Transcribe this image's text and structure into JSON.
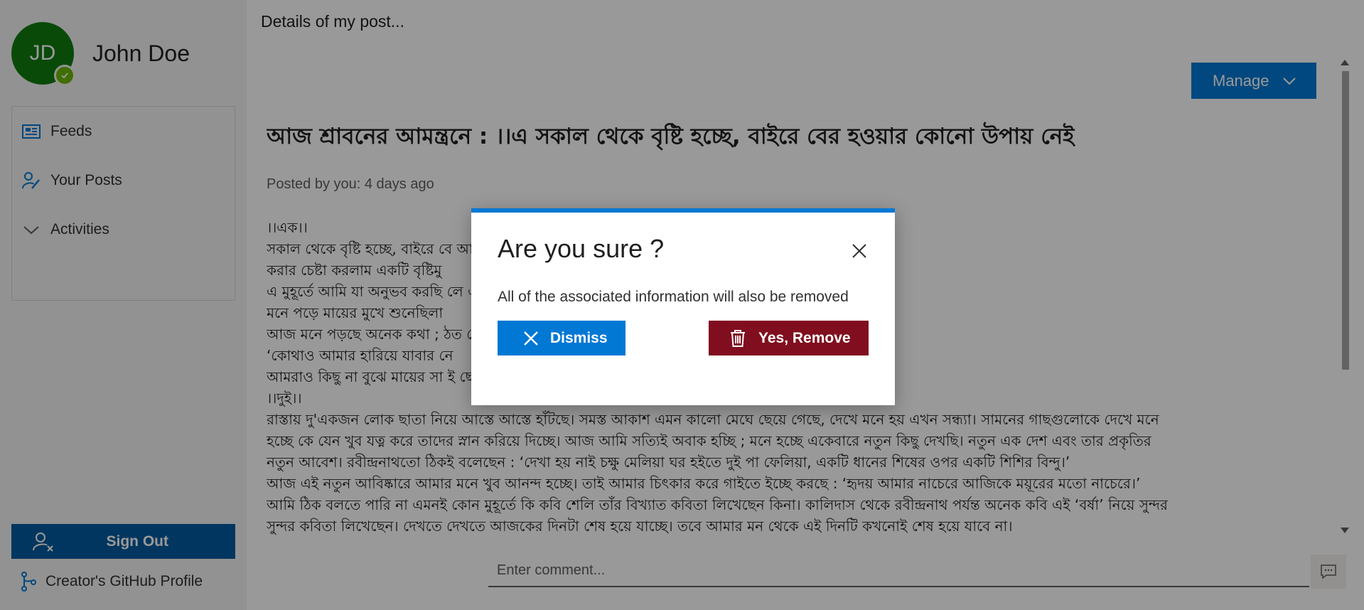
{
  "sidebar": {
    "avatar_initials": "JD",
    "user_name": "John Doe",
    "items": [
      {
        "label": "Feeds",
        "icon": "news-icon"
      },
      {
        "label": "Your Posts",
        "icon": "edit-person-icon"
      },
      {
        "label": "Activities",
        "icon": "chevron-down-icon"
      }
    ],
    "sign_out_label": "Sign Out",
    "github_label": "Creator's GitHub Profile"
  },
  "main": {
    "breadcrumb": "Details of my post...",
    "manage_label": "Manage",
    "post_title": "আজ শ্রাবনের আমন্ত্রনে : ।।এ সকাল থেকে বৃষ্টি হচ্ছে, বাইরে বের হওয়ার কোনো উপায় নেই",
    "post_meta": "Posted by you: 4 days ago",
    "body_lines": [
      "।।এক।।",
      "সকাল থেকে বৃষ্টি হচ্ছে, বাইরে বে                                                                আছি। এভাবেই আজকের দিনটি কাটিয়ে দিলাম। আর অনুভব",
      "করার চেষ্টা করলাম একটি বৃষ্টিমু",
      "এ মুহূর্তে আমি যা অনুভব করছি                                                                 লে এখনই রবীন্দ্রনাথের মতো লিখে ফেলতাম একটি কবিতা -",
      "মনে পড়ে মায়ের মুখে শুনেছিলা",
      "আজ মনে পড়ছে অনেক কথা ;                                                                   ঠত সেই গান –",
      "‘কোথাও আমার হারিয়ে যাবার নে",
      "আমরাও কিছু না বুঝে মায়ের সা                                                                 ই ছেলেবেলার দিনগুলোর কোন তুলনাই হয়না।",
      "।।দুই।।",
      "রাস্তায় দু'একজন লোক ছাতা নিয়ে আস্তে আস্তে হাঁটছে। সমস্ত আকাশ এমন কালো মেঘে ছেয়ে গেছে, দেখে মনে হয় এখন সন্ধ্যা। সামনের গাছগুলোকে দেখে মনে",
      "হচ্ছে কে যেন খুব যত্ন করে তাদের স্নান করিয়ে দিচ্ছে। আজ আমি সত্যিই অবাক হচ্ছি ; মনে হচ্ছে একেবারে নতুন কিছু দেখছি। নতুন এক দেশ এবং তার প্রকৃতির",
      "নতুন আবেশ। রবীন্দ্রনাথতো ঠিকই বলেছেন : ‘দেখা হয় নাই চক্ষু মেলিয়া ঘর হইতে দুই পা ফেলিয়া, একটি ধানের শিষের ওপর একটি শিশির বিন্দু।’",
      "আজ এই নতুন আবিষ্কারে আমার মনে খুব আনন্দ হচ্ছে। তাই আমার চিৎকার করে গাইতে ইচ্ছে করছে : ‘হৃদয় আমার নাচেরে আজিকে ময়ূরের মতো নাচেরে।’",
      "আমি ঠিক বলতে পারি না এমনই কোন মুহূর্তে কি কবি শেলি তাঁর বিখ্যাত কবিতা লিখেছেন কিনা। কালিদাস থেকে রবীন্দ্রনাথ পর্যন্ত অনেক কবি এই ‘বর্ষা’ নিয়ে সুন্দর",
      "সুন্দর কবিতা লিখেছেন। দেখতে দেখতে আজকের দিনটা শেষ হয়ে যাচ্ছে। তবে আমার মন থেকে এই দিনটি কখনোই শেষ হয়ে যাবে না।"
    ],
    "comment_placeholder": "Enter comment..."
  },
  "modal": {
    "title": "Are you sure ?",
    "message": "All of the associated information will also be removed",
    "dismiss_label": "Dismiss",
    "remove_label": "Yes, Remove"
  },
  "colors": {
    "accent": "#0078d4",
    "danger": "#800e1f",
    "avatar": "#107c10"
  }
}
